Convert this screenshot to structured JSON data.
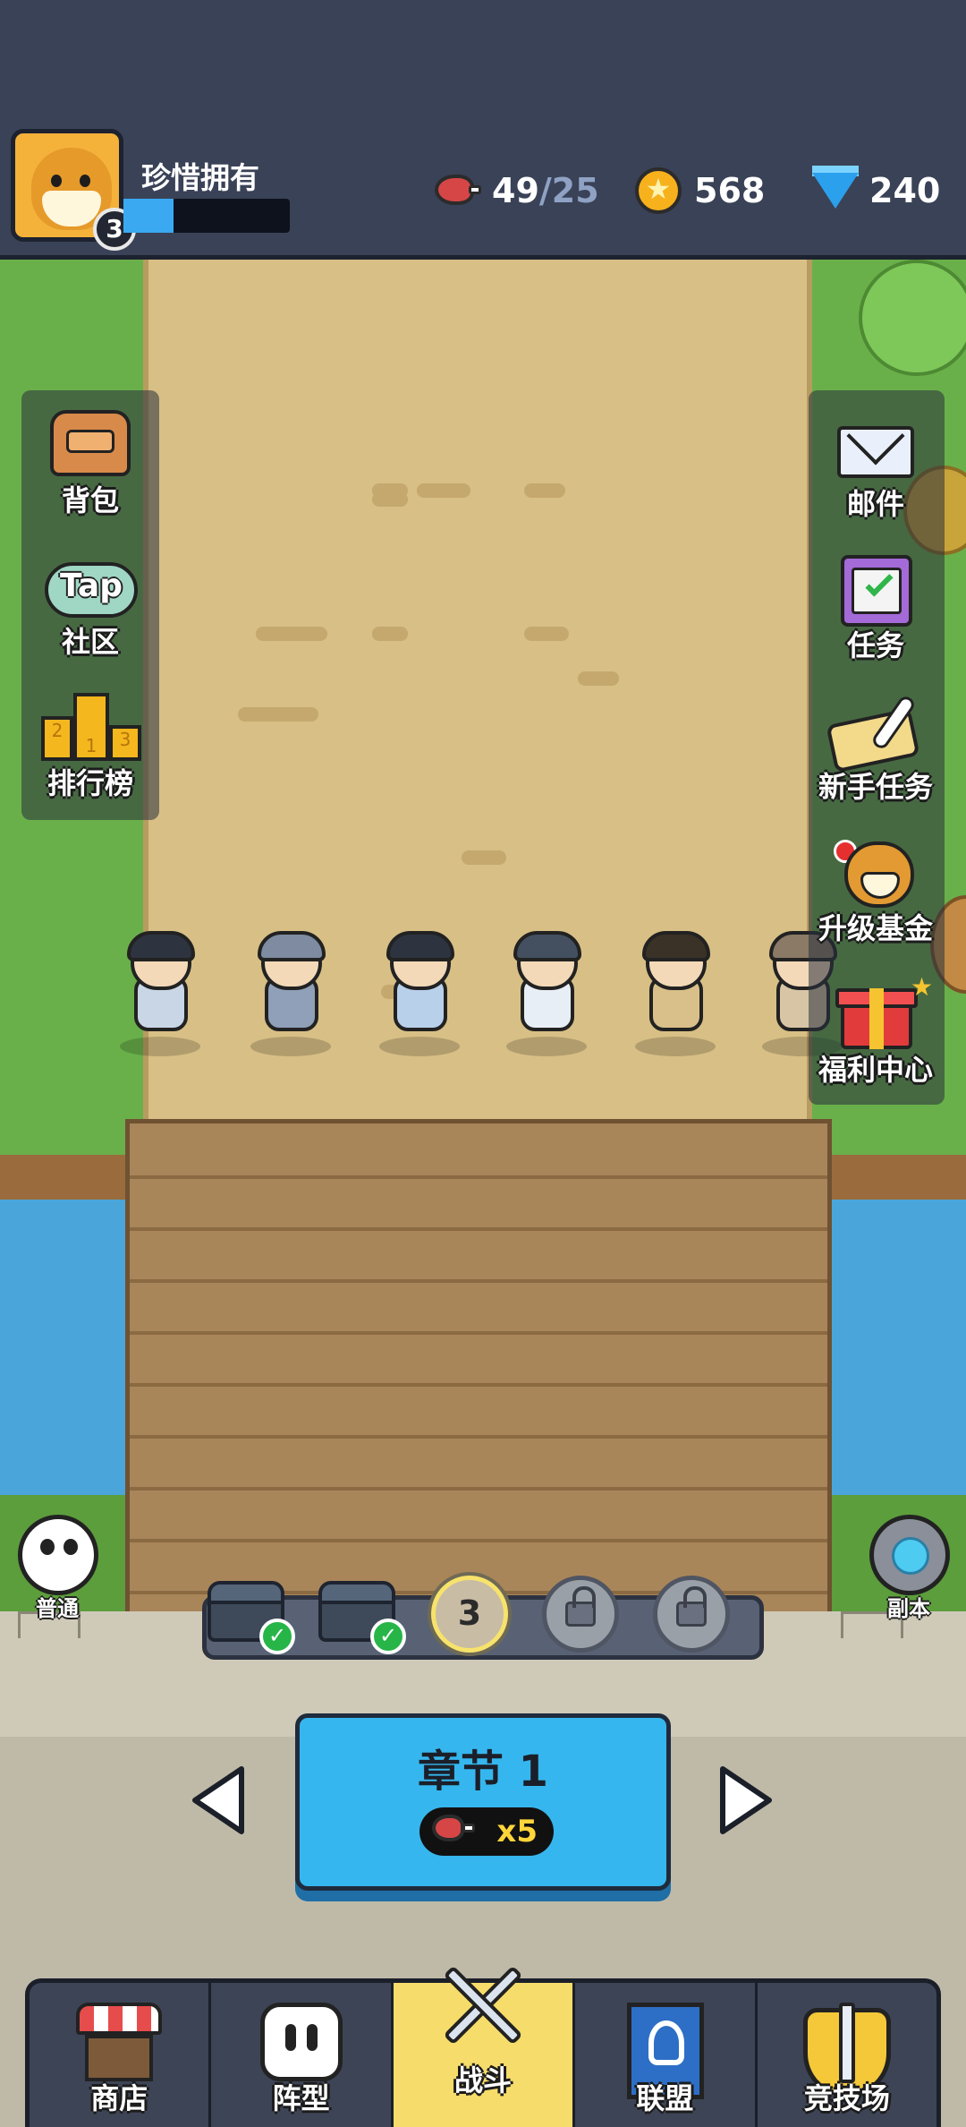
{
  "player": {
    "name": "珍惜拥有",
    "level": "3",
    "xp_fraction": 0.3
  },
  "resources": {
    "stamina_current": "49",
    "stamina_max": "/25",
    "coins": "568",
    "gems": "240"
  },
  "left_menu": [
    {
      "label": "背包",
      "icon": "backpack-icon"
    },
    {
      "label": "社区",
      "icon": "tap-community-icon",
      "icon_text": "Tap"
    },
    {
      "label": "排行榜",
      "icon": "leaderboard-icon",
      "podium": [
        "2",
        "1",
        "3"
      ]
    }
  ],
  "right_menu": [
    {
      "label": "邮件",
      "icon": "mail-icon"
    },
    {
      "label": "任务",
      "icon": "task-clipboard-icon"
    },
    {
      "label": "新手任务",
      "icon": "scroll-quill-icon"
    },
    {
      "label": "升级基金",
      "icon": "lion-fund-icon"
    },
    {
      "label": "福利中心",
      "icon": "gift-box-icon"
    }
  ],
  "modes": {
    "normal_label": "普通",
    "dungeon_label": "副本"
  },
  "stages": {
    "current_number": "3",
    "states": [
      "cleared",
      "cleared",
      "current",
      "locked",
      "locked"
    ]
  },
  "chapter": {
    "title": "章节 1",
    "cost": "x5"
  },
  "nav": [
    {
      "label": "商店",
      "icon": "shop-icon"
    },
    {
      "label": "阵型",
      "icon": "formation-icon"
    },
    {
      "label": "战斗",
      "icon": "crossed-swords-icon",
      "active": true
    },
    {
      "label": "联盟",
      "icon": "alliance-banner-icon"
    },
    {
      "label": "竞技场",
      "icon": "arena-shield-icon"
    }
  ],
  "colors": {
    "header_bg": "#3a4257",
    "xp_fill": "#3aa9f2",
    "chapter_card": "#36b6ee",
    "nav_active": "#f6dc6a",
    "cost_text": "#ffd53a"
  }
}
